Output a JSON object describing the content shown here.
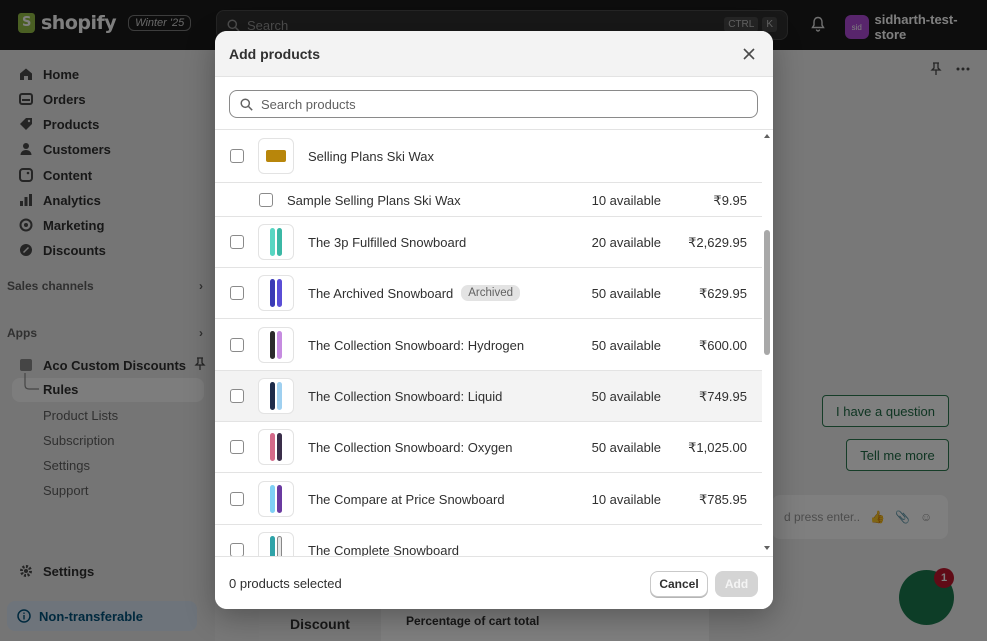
{
  "topbar": {
    "brand": "shopify",
    "edition": "Winter '25",
    "search_placeholder": "Search",
    "shortcut_keys": [
      "CTRL",
      "K"
    ],
    "store_initials": "sid",
    "store_name": "sidharth-test-store"
  },
  "sidebar": {
    "items": [
      {
        "label": "Home",
        "icon": "home-icon"
      },
      {
        "label": "Orders",
        "icon": "orders-icon"
      },
      {
        "label": "Products",
        "icon": "tag-icon"
      },
      {
        "label": "Customers",
        "icon": "person-icon"
      },
      {
        "label": "Content",
        "icon": "content-icon"
      },
      {
        "label": "Analytics",
        "icon": "chart-icon"
      },
      {
        "label": "Marketing",
        "icon": "target-icon"
      },
      {
        "label": "Discounts",
        "icon": "discount-icon"
      }
    ],
    "sales_channels": "Sales channels",
    "apps": "Apps",
    "app_name": "Aco Custom Discounts",
    "app_subitems": [
      "Rules",
      "Product Lists",
      "Subscription",
      "Settings",
      "Support"
    ],
    "settings": "Settings",
    "non_transferable": "Non-transferable"
  },
  "background": {
    "chat_question": "I have a question",
    "chat_more": "Tell me more",
    "chat_input_placeholder": "d press enter..",
    "chat_badge": "1",
    "table_header": "Discount",
    "table_value": "Percentage of cart total"
  },
  "modal": {
    "title": "Add products",
    "search_placeholder": "Search products",
    "parent_product": "Selling Plans Ski Wax",
    "variant": {
      "name": "Sample Selling Plans Ski Wax",
      "available": "10 available",
      "price": "₹9.95"
    },
    "products": [
      {
        "name": "The 3p Fulfilled Snowboard",
        "available": "20 available",
        "price": "₹2,629.95",
        "badge": ""
      },
      {
        "name": "The Archived Snowboard",
        "available": "50 available",
        "price": "₹629.95",
        "badge": "Archived"
      },
      {
        "name": "The Collection Snowboard: Hydrogen",
        "available": "50 available",
        "price": "₹600.00",
        "badge": ""
      },
      {
        "name": "The Collection Snowboard: Liquid",
        "available": "50 available",
        "price": "₹749.95",
        "badge": ""
      },
      {
        "name": "The Collection Snowboard: Oxygen",
        "available": "50 available",
        "price": "₹1,025.00",
        "badge": ""
      },
      {
        "name": "The Compare at Price Snowboard",
        "available": "10 available",
        "price": "₹785.95",
        "badge": ""
      },
      {
        "name": "The Complete Snowboard",
        "available": "",
        "price": "",
        "badge": ""
      }
    ],
    "footer_status": "0 products selected",
    "cancel_label": "Cancel",
    "add_label": "Add"
  }
}
